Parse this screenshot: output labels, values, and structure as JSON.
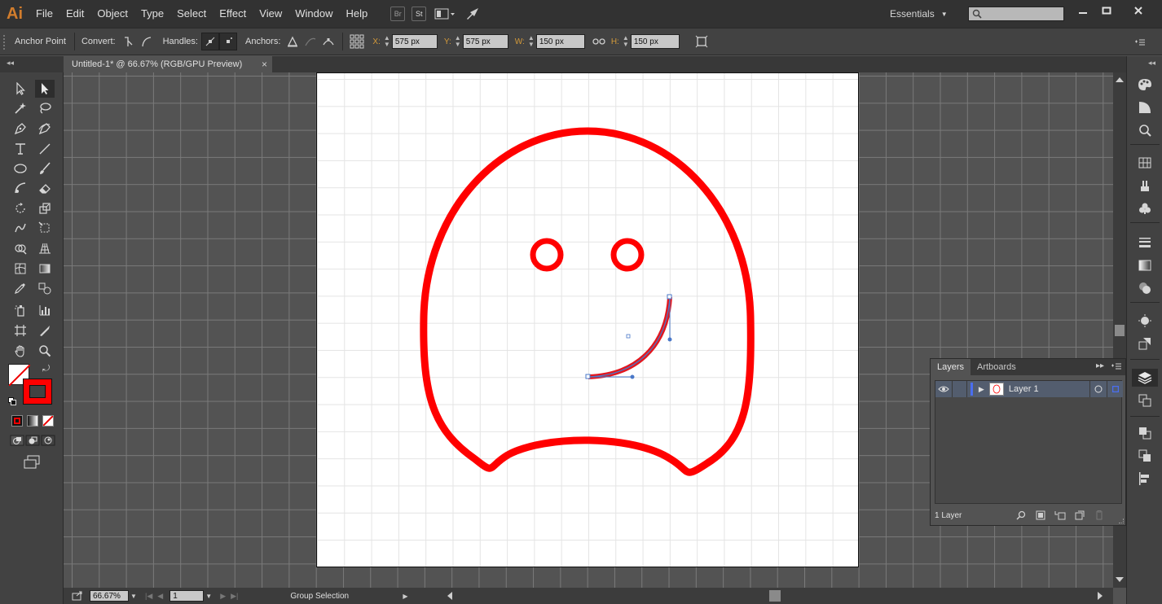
{
  "app": {
    "logo_text": "Ai",
    "menus": [
      "File",
      "Edit",
      "Object",
      "Type",
      "Select",
      "Effect",
      "View",
      "Window",
      "Help"
    ],
    "bridge_label": "Br",
    "stock_label": "St",
    "workspace": "Essentials",
    "search_placeholder": ""
  },
  "controlbar": {
    "tool_name": "Anchor Point",
    "convert_label": "Convert:",
    "handles_label": "Handles:",
    "anchors_label": "Anchors:",
    "x_label": "X:",
    "x_value": "575 px",
    "y_label": "Y:",
    "y_value": "575 px",
    "w_label": "W:",
    "w_value": "150 px",
    "h_label": "H:",
    "h_value": "150 px"
  },
  "document": {
    "tab_title": "Untitled-1* @ 66.67% (RGB/GPU Preview)"
  },
  "layers_panel": {
    "tabs": [
      "Layers",
      "Artboards"
    ],
    "layer_name": "Layer 1",
    "layer_count": "1 Layer"
  },
  "statusbar": {
    "zoom": "66.67%",
    "artboard_number": "1",
    "current_tool": "Group Selection"
  },
  "colors": {
    "stroke_red": "#ff0000",
    "selection_blue": "#4a78c8",
    "accent_orange": "#d49a3a"
  }
}
